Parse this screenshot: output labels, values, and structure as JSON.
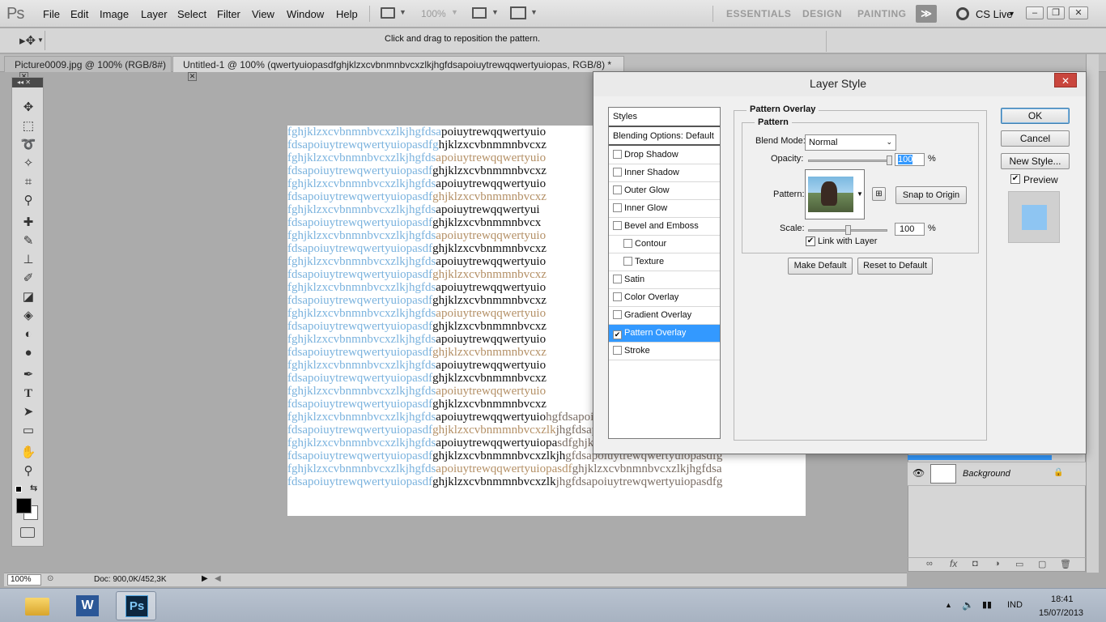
{
  "app": {
    "logo": "Ps"
  },
  "menu": {
    "items": [
      "File",
      "Edit",
      "Image",
      "Layer",
      "Select",
      "Filter",
      "View",
      "Window",
      "Help"
    ]
  },
  "appbar": {
    "zoom": "100%"
  },
  "workspaces": {
    "essentials": "ESSENTIALS",
    "design": "DESIGN",
    "painting": "PAINTING",
    "more": "≫",
    "cs_live": "CS Live"
  },
  "options": {
    "hint": "Click and drag to reposition the pattern."
  },
  "tabs": [
    {
      "label": "Picture0009.jpg @ 100% (RGB/8#)"
    },
    {
      "label": "Untitled-1 @ 100% (qwertyuiopasdfghjklzxcvbnmnbvcxzlkjhgfdsapoiuytrewqqwertyuiopas, RGB/8) *"
    }
  ],
  "canvas": {
    "rows": [
      [
        "fghjklzxcvbnmnbvcxzlkjhgfdsa",
        "poiuytrewqqwertyuio",
        ""
      ],
      [
        "fdsapoiuytrewqwertyuiopasdfg",
        "hjklzxcvbnmmnbvcxz",
        ""
      ],
      [
        "fghjklzxcvbnmnbvcxzlkjhgfds",
        "apoiuytrewqqwertyuio",
        ""
      ],
      [
        "fdsapoiuytrewqwertyuiopasdf",
        "ghjklzxcvbnmmnbvcxz",
        ""
      ],
      [
        "fghjklzxcvbnmnbvcxzlkjhgfds",
        "apoiuytrewqqwertyuio",
        ""
      ],
      [
        "fdsapoiuytrewqwertyuiopasdf",
        "ghjklzxcvbnmmnbvcxz",
        ""
      ],
      [
        "fghjklzxcvbnmnbvcxzlkjhgfds",
        "apoiuytrewqqwertyui",
        ""
      ],
      [
        "fdsapoiuytrewqwertyuiopasdf",
        "ghjklzxcvbnmmnbvcx",
        ""
      ],
      [
        "fghjklzxcvbnmnbvcxzlkjhgfds",
        "apoiuytrewqqwertyuio",
        ""
      ],
      [
        "fdsapoiuytrewqwertyuiopasdf",
        "ghjklzxcvbnmmnbvcxz",
        ""
      ],
      [
        "fghjklzxcvbnmnbvcxzlkjhgfds",
        "apoiuytrewqqwertyuio",
        ""
      ],
      [
        "fdsapoiuytrewqwertyuiopasdf",
        "ghjklzxcvbnmmnbvcxz",
        ""
      ],
      [
        "fghjklzxcvbnmnbvcxzlkjhgfds",
        "apoiuytrewqqwertyuio",
        ""
      ],
      [
        "fdsapoiuytrewqwertyuiopasdf",
        "ghjklzxcvbnmmnbvcxz",
        ""
      ],
      [
        "fghjklzxcvbnmnbvcxzlkjhgfds",
        "apoiuytrewqqwertyuio",
        ""
      ],
      [
        "fdsapoiuytrewqwertyuiopasdf",
        "ghjklzxcvbnmmnbvcxz",
        ""
      ],
      [
        "fghjklzxcvbnmnbvcxzlkjhgfds",
        "apoiuytrewqqwertyuio",
        ""
      ],
      [
        "fdsapoiuytrewqwertyuiopasdf",
        "ghjklzxcvbnmmnbvcxz",
        ""
      ],
      [
        "fghjklzxcvbnmnbvcxzlkjhgfds",
        "apoiuytrewqqwertyuio",
        ""
      ],
      [
        "fdsapoiuytrewqwertyuiopasdf",
        "ghjklzxcvbnmmnbvcxz",
        ""
      ],
      [
        "fghjklzxcvbnmnbvcxzlkjhgfds",
        "apoiuytrewqqwertyuio",
        ""
      ],
      [
        "fdsapoiuytrewqwertyuiopasdf",
        "ghjklzxcvbnmmnbvcxz",
        ""
      ],
      [
        "fghjklzxcvbnmnbvcxzlkjhgfds",
        "apoiuytrewqqwertyuio",
        "hgfdsapoiuytrewqwertyuiopasdfgh"
      ],
      [
        "fdsapoiuytrewqwertyuiopasdf",
        "ghjklzxcvbnmmnbvcxzlk",
        "jhgfdsapoiuytrewqwertyuiopasdfg"
      ],
      [
        "fghjklzxcvbnmnbvcxzlkjhgfds",
        "apoiuytrewqqwertyuiopa",
        "sdfghjklzxcvbnmnbvcxzlkjhgfdsa"
      ],
      [
        "fdsapoiuytrewqwertyuiopasdf",
        "ghjklzxcvbnmmnbvcxzlkjh",
        "gfdsapoiuytrewqwertyuiopasdfg"
      ],
      [
        "fghjklzxcvbnmnbvcxzlkjhgfds",
        "apoiuytrewqqwertyuiopasdf",
        "ghjklzxcvbnmnbvcxzlkjhgfdsa"
      ],
      [
        "fdsapoiuytrewqwertyuiopasdf",
        "ghjklzxcvbnmmnbvcxzlk",
        "jhgfdsapoiuytrewqwertyuiopasdfg"
      ]
    ]
  },
  "status": {
    "zoom": "100%",
    "doc": "Doc: 900,0K/452,3K"
  },
  "layers": {
    "background": "Background"
  },
  "dialog": {
    "title": "Layer Style",
    "styles_header": "Styles",
    "blending_options": "Blending Options: Default",
    "items": [
      {
        "label": "Drop Shadow",
        "checked": false,
        "indent": false,
        "selected": false
      },
      {
        "label": "Inner Shadow",
        "checked": false,
        "indent": false,
        "selected": false
      },
      {
        "label": "Outer Glow",
        "checked": false,
        "indent": false,
        "selected": false
      },
      {
        "label": "Inner Glow",
        "checked": false,
        "indent": false,
        "selected": false
      },
      {
        "label": "Bevel and Emboss",
        "checked": false,
        "indent": false,
        "selected": false
      },
      {
        "label": "Contour",
        "checked": false,
        "indent": true,
        "selected": false
      },
      {
        "label": "Texture",
        "checked": false,
        "indent": true,
        "selected": false
      },
      {
        "label": "Satin",
        "checked": false,
        "indent": false,
        "selected": false
      },
      {
        "label": "Color Overlay",
        "checked": false,
        "indent": false,
        "selected": false
      },
      {
        "label": "Gradient Overlay",
        "checked": false,
        "indent": false,
        "selected": false
      },
      {
        "label": "Pattern Overlay",
        "checked": true,
        "indent": false,
        "selected": true
      },
      {
        "label": "Stroke",
        "checked": false,
        "indent": false,
        "selected": false
      }
    ],
    "section_title": "Pattern Overlay",
    "subsection_title": "Pattern",
    "blend_mode_label": "Blend Mode:",
    "blend_mode_value": "Normal",
    "opacity_label": "Opacity:",
    "opacity_value": "100",
    "opacity_level": 1.0,
    "percent": "%",
    "pattern_label": "Pattern:",
    "snap_to_origin": "Snap to Origin",
    "scale_label": "Scale:",
    "scale_value": "100",
    "scale_level": 0.5,
    "link_with_layer": "Link with Layer",
    "make_default": "Make Default",
    "reset_to_default": "Reset to Default",
    "ok": "OK",
    "cancel": "Cancel",
    "new_style": "New Style...",
    "preview": "Preview"
  },
  "taskbar": {
    "lang": "IND",
    "time": "18:41",
    "date": "15/07/2013"
  },
  "colors": {
    "selection": "#3399ff",
    "accent_blue": "#7bb3de",
    "close_red": "#c9463d"
  }
}
